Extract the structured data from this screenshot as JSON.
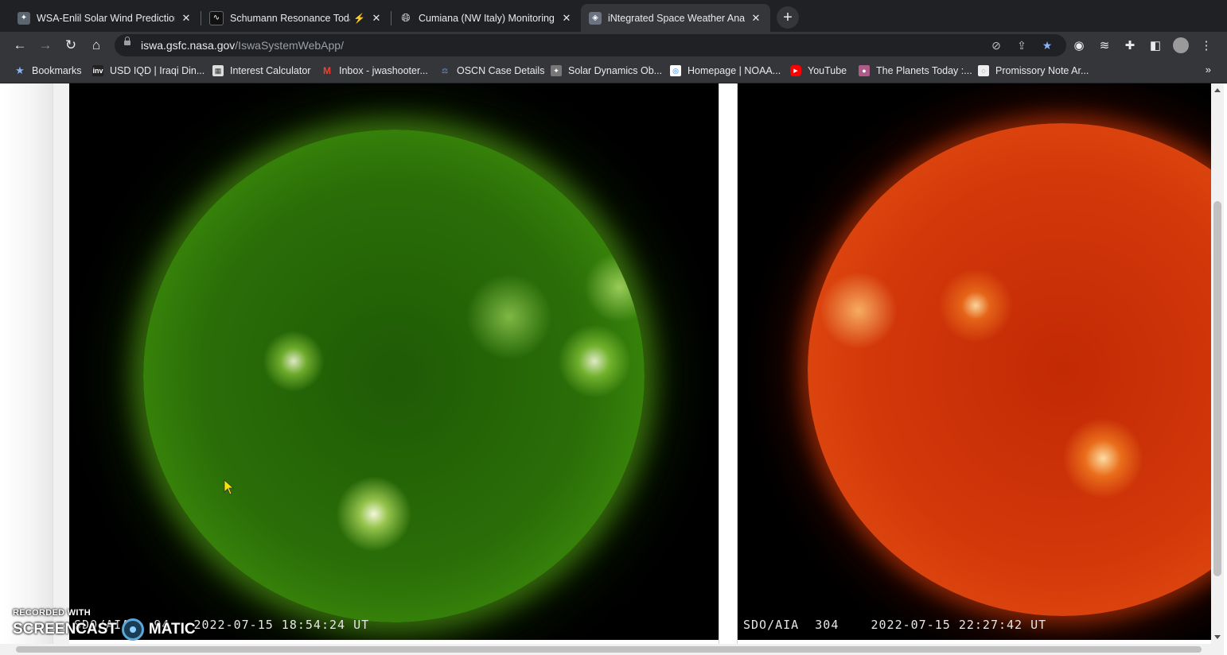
{
  "tabs": [
    {
      "title": "WSA-Enlil Solar Wind Prediction",
      "icon": "nasa-icon",
      "active": false
    },
    {
      "title": "Schumann Resonance Today",
      "icon": "schumann-icon",
      "badge": "⚡",
      "active": false
    },
    {
      "title": "Cumiana (NW Italy) Monitoring S",
      "icon": "globe-icon",
      "active": false
    },
    {
      "title": "iNtegrated Space Weather Analy",
      "icon": "iswa-icon",
      "active": true
    }
  ],
  "toolbar": {
    "url_host": "iswa.gsfc.nasa.gov",
    "url_path": "/IswaSystemWebApp/"
  },
  "bookmarks": [
    {
      "label": "Bookmarks",
      "icon": "star-icon"
    },
    {
      "label": "USD IQD | Iraqi Din...",
      "icon": "inv-icon"
    },
    {
      "label": "Interest Calculator",
      "icon": "calculator-icon"
    },
    {
      "label": "Inbox - jwashooter...",
      "icon": "gmail-icon"
    },
    {
      "label": "OSCN Case Details",
      "icon": "oscn-icon"
    },
    {
      "label": "Solar Dynamics Ob...",
      "icon": "sdo-icon"
    },
    {
      "label": "Homepage | NOAA...",
      "icon": "noaa-icon"
    },
    {
      "label": "YouTube",
      "icon": "youtube-icon"
    },
    {
      "label": "The Planets Today :...",
      "icon": "planets-icon"
    },
    {
      "label": "Promissory Note Ar...",
      "icon": "promissory-icon"
    }
  ],
  "images": {
    "left": {
      "instrument": "SDO/AIA",
      "wavelength": "94",
      "timestamp": "2022-07-15 18:54:24 UT",
      "color": "#3d8c0c"
    },
    "right": {
      "instrument": "SDO/AIA",
      "wavelength": "304",
      "timestamp": "2022-07-15 22:27:42 UT",
      "color": "#d3380a"
    }
  },
  "watermark": {
    "top": "RECORDED WITH",
    "left": "SCREENCAST",
    "right": "MATIC"
  }
}
